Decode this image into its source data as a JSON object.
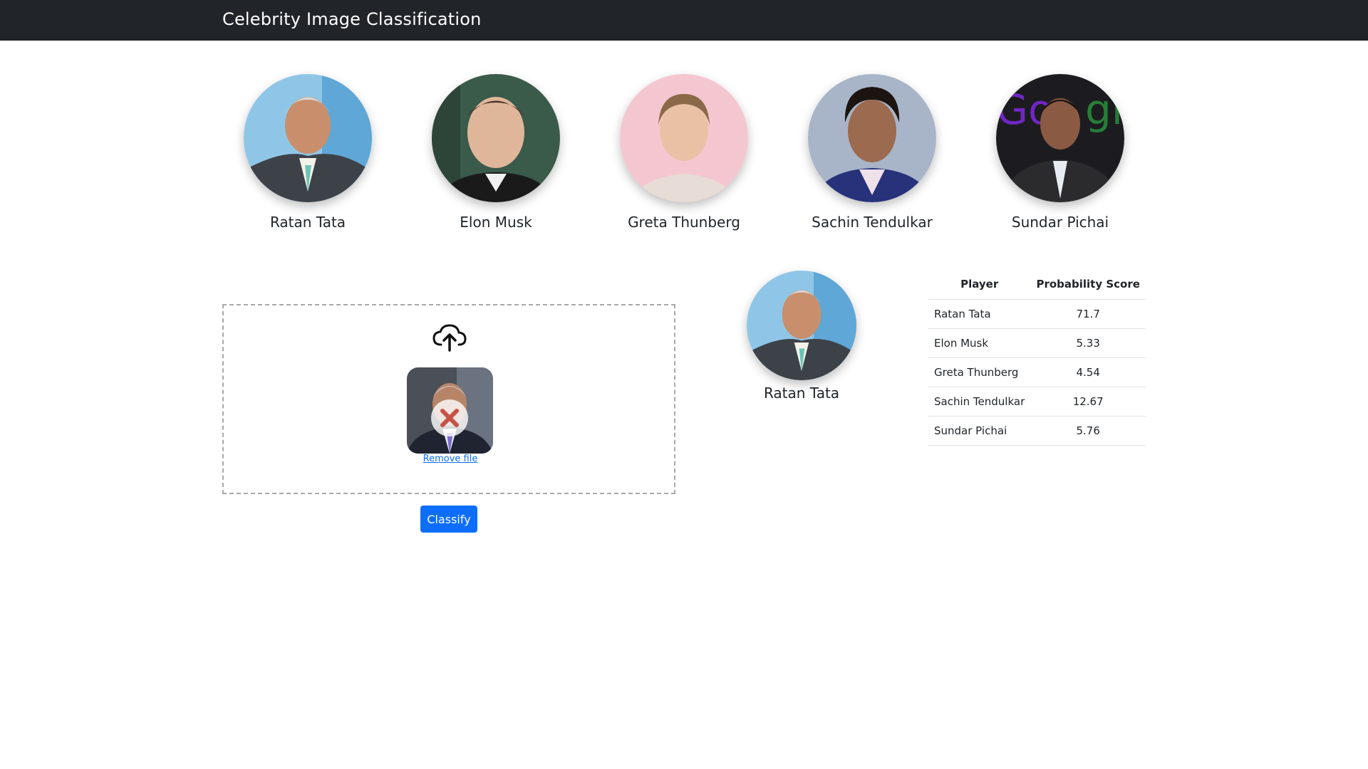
{
  "navbar": {
    "title": "Celebrity Image Classification"
  },
  "celebrities": [
    {
      "name": "Ratan Tata",
      "photo": "ratan-tata-photo"
    },
    {
      "name": "Elon Musk",
      "photo": "elon-musk-photo"
    },
    {
      "name": "Greta Thunberg",
      "photo": "greta-thunberg-photo"
    },
    {
      "name": "Sachin Tendulkar",
      "photo": "sachin-tendulkar-photo"
    },
    {
      "name": "Sundar Pichai",
      "photo": "sundar-pichai-photo"
    }
  ],
  "dropzone": {
    "icon": "cloud-upload-icon",
    "remove_label": "Remove file",
    "remove_icon": "remove-x-icon"
  },
  "classify_button": "Classify",
  "result": {
    "name": "Ratan Tata"
  },
  "table": {
    "headers": [
      "Player",
      "Probability Score"
    ],
    "rows": [
      {
        "player": "Ratan Tata",
        "score": "71.7"
      },
      {
        "player": "Elon Musk",
        "score": "5.33"
      },
      {
        "player": "Greta Thunberg",
        "score": "4.54"
      },
      {
        "player": "Sachin Tendulkar",
        "score": "12.67"
      },
      {
        "player": "Sundar Pichai",
        "score": "5.76"
      }
    ]
  },
  "colors": {
    "navbar": "#212529",
    "primary": "#0d6efd",
    "remove_x": "#c0392b"
  }
}
